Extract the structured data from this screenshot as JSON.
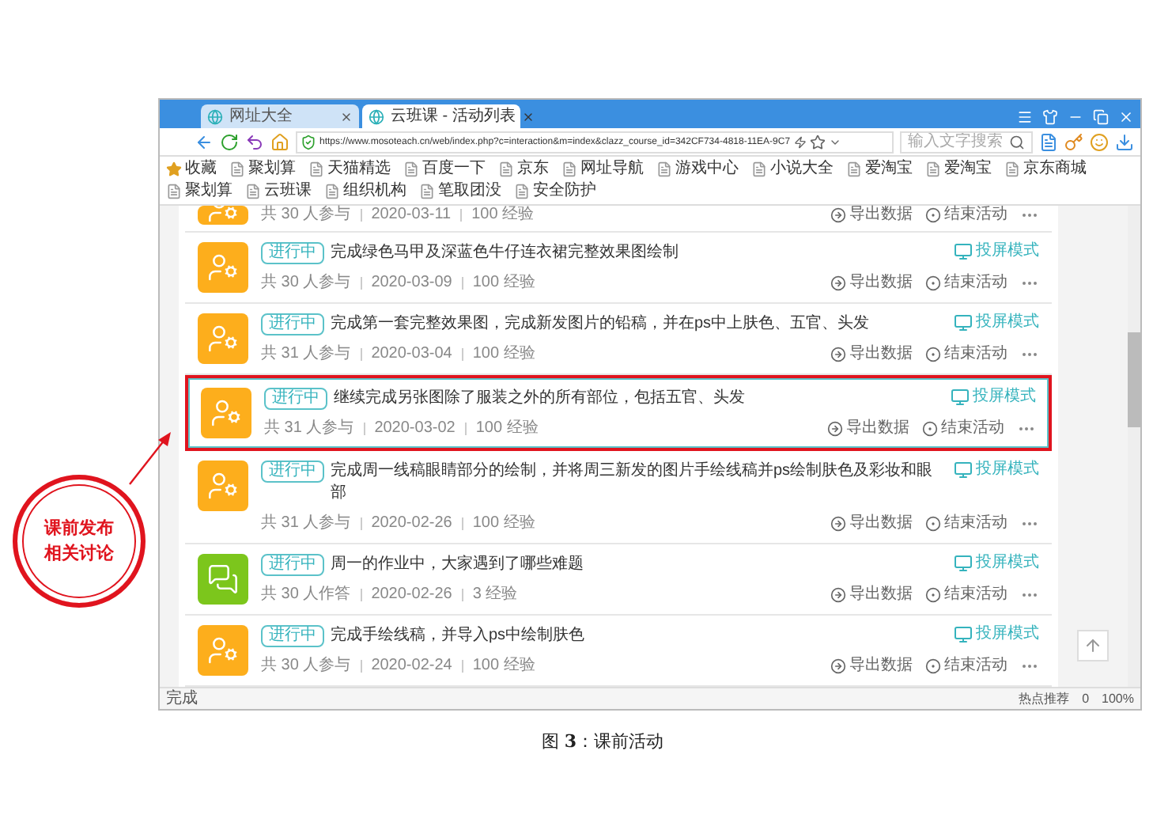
{
  "browser": {
    "tabs": [
      {
        "title": "网址大全",
        "selected": false
      },
      {
        "title": "云班课 - 活动列表",
        "selected": true
      }
    ],
    "address": "https://www.mosoteach.cn/web/index.php?c=interaction&m=index&clazz_course_id=342CF734-4818-11EA-9C7",
    "search": {
      "placeholder": "输入文字搜索"
    },
    "bookmarks": [
      {
        "label": "收藏",
        "kind": "favorites"
      },
      {
        "label": "聚划算",
        "kind": "link"
      },
      {
        "label": "天猫精选",
        "kind": "link"
      },
      {
        "label": "百度一下",
        "kind": "link"
      },
      {
        "label": "京东",
        "kind": "link"
      },
      {
        "label": "网址导航",
        "kind": "link"
      },
      {
        "label": "游戏中心",
        "kind": "link"
      },
      {
        "label": "小说大全",
        "kind": "link"
      },
      {
        "label": "爱淘宝",
        "kind": "link"
      },
      {
        "label": "爱淘宝",
        "kind": "link"
      },
      {
        "label": "京东商城",
        "kind": "link"
      },
      {
        "label": "聚划算",
        "kind": "link"
      },
      {
        "label": "云班课",
        "kind": "link"
      },
      {
        "label": "组织机构",
        "kind": "link"
      },
      {
        "label": "笔取团没",
        "kind": "link"
      },
      {
        "label": "安全防护",
        "kind": "link"
      }
    ]
  },
  "activities": [
    {
      "kind": "activity",
      "meta": [
        "共 30 人参与",
        "2020-03-11",
        "100 经验"
      ],
      "actions": [
        "导出数据",
        "结束活动"
      ],
      "selected": false
    },
    {
      "kind": "activity",
      "status": "进行中",
      "title": "完成绿色马甲及深蓝色牛仔连衣裙完整效果图绘制",
      "screen_mode": "投屏模式",
      "meta": [
        "共 30 人参与",
        "2020-03-09",
        "100 经验"
      ],
      "actions": [
        "导出数据",
        "结束活动"
      ],
      "selected": false
    },
    {
      "kind": "activity",
      "status": "进行中",
      "title": "完成第一套完整效果图，完成新发图片的铅稿，并在ps中上肤色、五官、头发",
      "screen_mode": "投屏模式",
      "meta": [
        "共 31 人参与",
        "2020-03-04",
        "100 经验"
      ],
      "actions": [
        "导出数据",
        "结束活动"
      ],
      "selected": false
    },
    {
      "kind": "activity",
      "status": "进行中",
      "title": "继续完成另张图除了服装之外的所有部位，包括五官、头发",
      "screen_mode": "投屏模式",
      "meta": [
        "共 31 人参与",
        "2020-03-02",
        "100 经验"
      ],
      "actions": [
        "导出数据",
        "结束活动"
      ],
      "selected": true
    },
    {
      "kind": "activity",
      "status": "进行中",
      "title": "完成周一线稿眼睛部分的绘制，并将周三新发的图片手绘线稿并ps绘制肤色及彩妆和眼部",
      "screen_mode": "投屏模式",
      "meta": [
        "共 31 人参与",
        "2020-02-26",
        "100 经验"
      ],
      "actions": [
        "导出数据",
        "结束活动"
      ],
      "selected": false
    },
    {
      "kind": "discussion",
      "status": "进行中",
      "title": "周一的作业中，大家遇到了哪些难题",
      "screen_mode": "投屏模式",
      "meta": [
        "共 30 人作答",
        "2020-02-26",
        "3 经验"
      ],
      "actions": [
        "导出数据",
        "结束活动"
      ],
      "selected": false
    },
    {
      "kind": "activity",
      "status": "进行中",
      "title": "完成手绘线稿，并导入ps中绘制肤色",
      "screen_mode": "投屏模式",
      "meta": [
        "共 30 人参与",
        "2020-02-24",
        "100 经验"
      ],
      "actions": [
        "导出数据",
        "结束活动"
      ],
      "selected": false
    }
  ],
  "status_bar": {
    "text": "完成",
    "items": [
      "热点推荐",
      "0",
      "100%"
    ]
  },
  "callout": {
    "lines": [
      "课前发布",
      "相关讨论"
    ]
  },
  "caption": "图 **3**：课前活动"
}
